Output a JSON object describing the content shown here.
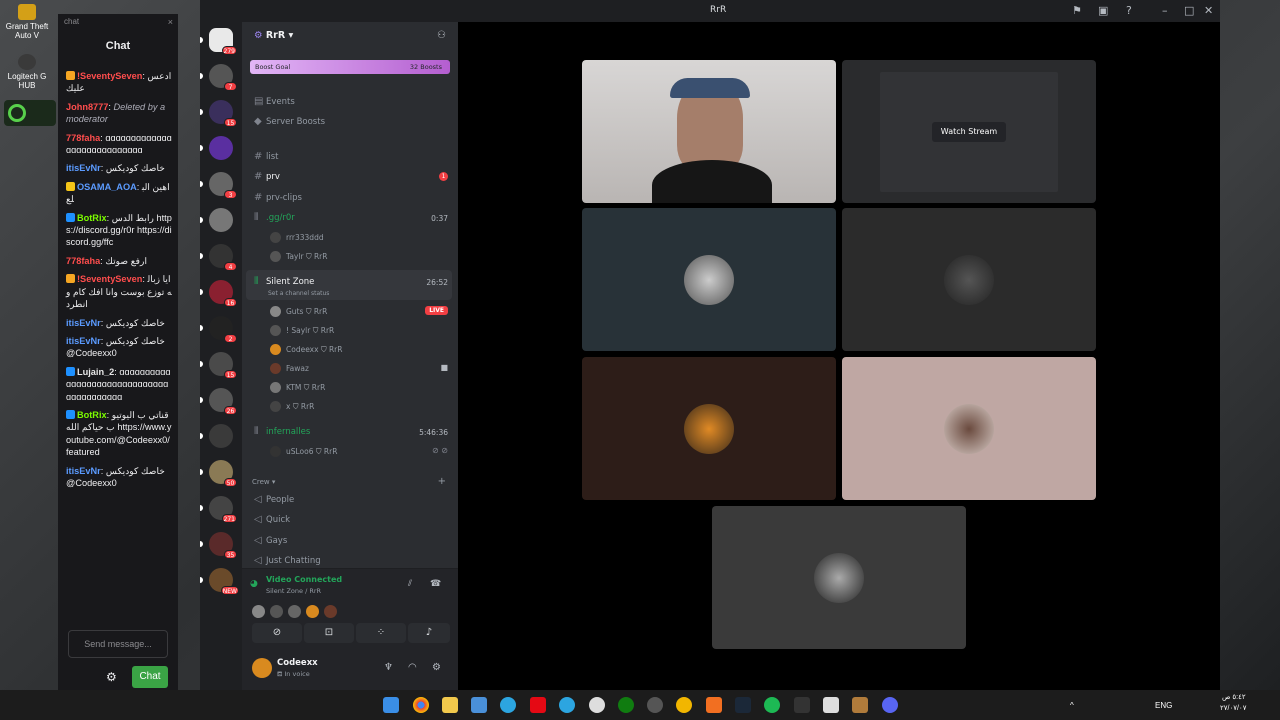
{
  "desktop": {
    "icons": [
      {
        "label": "Grand Theft Auto V",
        "color": "#d4a017"
      },
      {
        "label": "Logitech G HUB",
        "color": "#3a3a3a"
      }
    ]
  },
  "chat": {
    "window_label": "chat",
    "title": "Chat",
    "close": "×",
    "messages": [
      {
        "user": "!SeventySeven",
        "color": "#ff4d4d",
        "badge": "#f5a623",
        "text": "ادعس عليك"
      },
      {
        "user": "John8777",
        "color": "#ff4d4d",
        "text": "Deleted by a moderator",
        "deleted": true
      },
      {
        "user": "778faha",
        "color": "#ff4d4d",
        "text": "ɑɑɑɑɑɑɑɑɑɑɑɑɑɑɑɑɑɑɑɑɑɑɑɑɑɑɑɑ"
      },
      {
        "user": "itisEvNr",
        "color": "#5b9bff",
        "text": "خاصك كوديكس"
      },
      {
        "user": "OSAMA_AOA",
        "color": "#5b9bff",
        "badge": "#f5c518",
        "text": "اهين البلع"
      },
      {
        "user": "BotRix",
        "color": "#7cfc00",
        "badge": "#1e90ff",
        "text": "رابط الدس https://discord.gg/r0r https://discord.gg/ffc"
      },
      {
        "user": "778faha",
        "color": "#ff4d4d",
        "text": "ارفع صوتك"
      },
      {
        "user": "!SeventySeven",
        "color": "#ff4d4d",
        "badge": "#f5a623",
        "text": "ايا زباله توزع بوست وانا افك كام وانطرد"
      },
      {
        "user": "itisEvNr",
        "color": "#5b9bff",
        "text": "خاصك كوديكس"
      },
      {
        "user": "itisEvNr",
        "color": "#5b9bff",
        "text": "خاصك كوديكس @Codeexx0"
      },
      {
        "user": "Lujain_2",
        "color": "#e8e8e8",
        "badge": "#1e90ff",
        "text": "ɑɑɑɑɑɑɑɑɑɑɑɑɑɑɑɑɑɑɑɑɑɑɑɑɑɑɑɑɑɑɑɑɑɑɑɑɑɑɑɑɑ"
      },
      {
        "user": "BotRix",
        "color": "#7cfc00",
        "badge": "#1e90ff",
        "text": "قناتي ب اليوتيوب حياكم الله https://www.youtube.com/@Codeexx0/featured"
      },
      {
        "user": "itisEvNr",
        "color": "#5b9bff",
        "text": "خاصك كوديكس @Codeexx0"
      }
    ],
    "send_placeholder": "Send message...",
    "chat_button": "Chat"
  },
  "discord": {
    "window_title": "RrR",
    "server_name": "RrR",
    "boost_goal": "Boost Goal",
    "boosts": "32 Boosts",
    "rail_pings": [
      "279",
      "7",
      "15",
      "",
      "3",
      "",
      "4",
      "16",
      "2",
      "15",
      "26",
      "",
      "50",
      "271",
      "35",
      "NEW"
    ],
    "top_items": [
      {
        "label": "Events",
        "icon": "calendar-icon"
      },
      {
        "label": "Server Boosts",
        "icon": "boost-icon"
      }
    ],
    "text_channels": [
      {
        "label": "list",
        "bold": false
      },
      {
        "label": "prv",
        "bold": true,
        "mention": "1"
      },
      {
        "label": "prv-clips",
        "bold": false
      }
    ],
    "voice_channels": [
      {
        "label": ".gg/r0r",
        "time": "0:37",
        "users": [
          {
            "name": "rrr333ddd",
            "tag": ""
          },
          {
            "name": "Taylr",
            "tag": "RrR"
          }
        ]
      },
      {
        "label": "Silent Zone",
        "time": "26:52",
        "status": "Set a channel status",
        "users": [
          {
            "name": "Guts",
            "tag": "RrR",
            "live": "LIVE"
          },
          {
            "name": "! Saylr",
            "tag": "RrR"
          },
          {
            "name": "Codeexx",
            "tag": "RrR"
          },
          {
            "name": "Fawaz",
            "tag": ""
          },
          {
            "name": "KTM",
            "tag": "RrR"
          },
          {
            "name": "x",
            "tag": "RrR"
          }
        ]
      },
      {
        "label": "infernalles",
        "time": "5:46:36",
        "users": [
          {
            "name": "uSLoo6",
            "tag": "RrR"
          }
        ]
      }
    ],
    "category": "Crew",
    "crew_channels": [
      "People",
      "Quick",
      "Gays",
      "Just Chatting"
    ],
    "voice_status": {
      "title": "Video Connected",
      "sub": "Silent Zone / RrR"
    },
    "user": {
      "name": "Codeexx",
      "status": "In voice"
    },
    "watch_stream": "Watch Stream",
    "tiles_colors": [
      "#c9c6c5",
      "#2a2b2d",
      "#283238",
      "#2b2b2b",
      "#2d1d18",
      "#bfa7a3",
      "#3a3a3a"
    ]
  },
  "taskbar": {
    "lang": "ENG",
    "clock_time": "٥:٤٢ ص",
    "clock_date": "٢٧/٠٧/٠٧"
  }
}
